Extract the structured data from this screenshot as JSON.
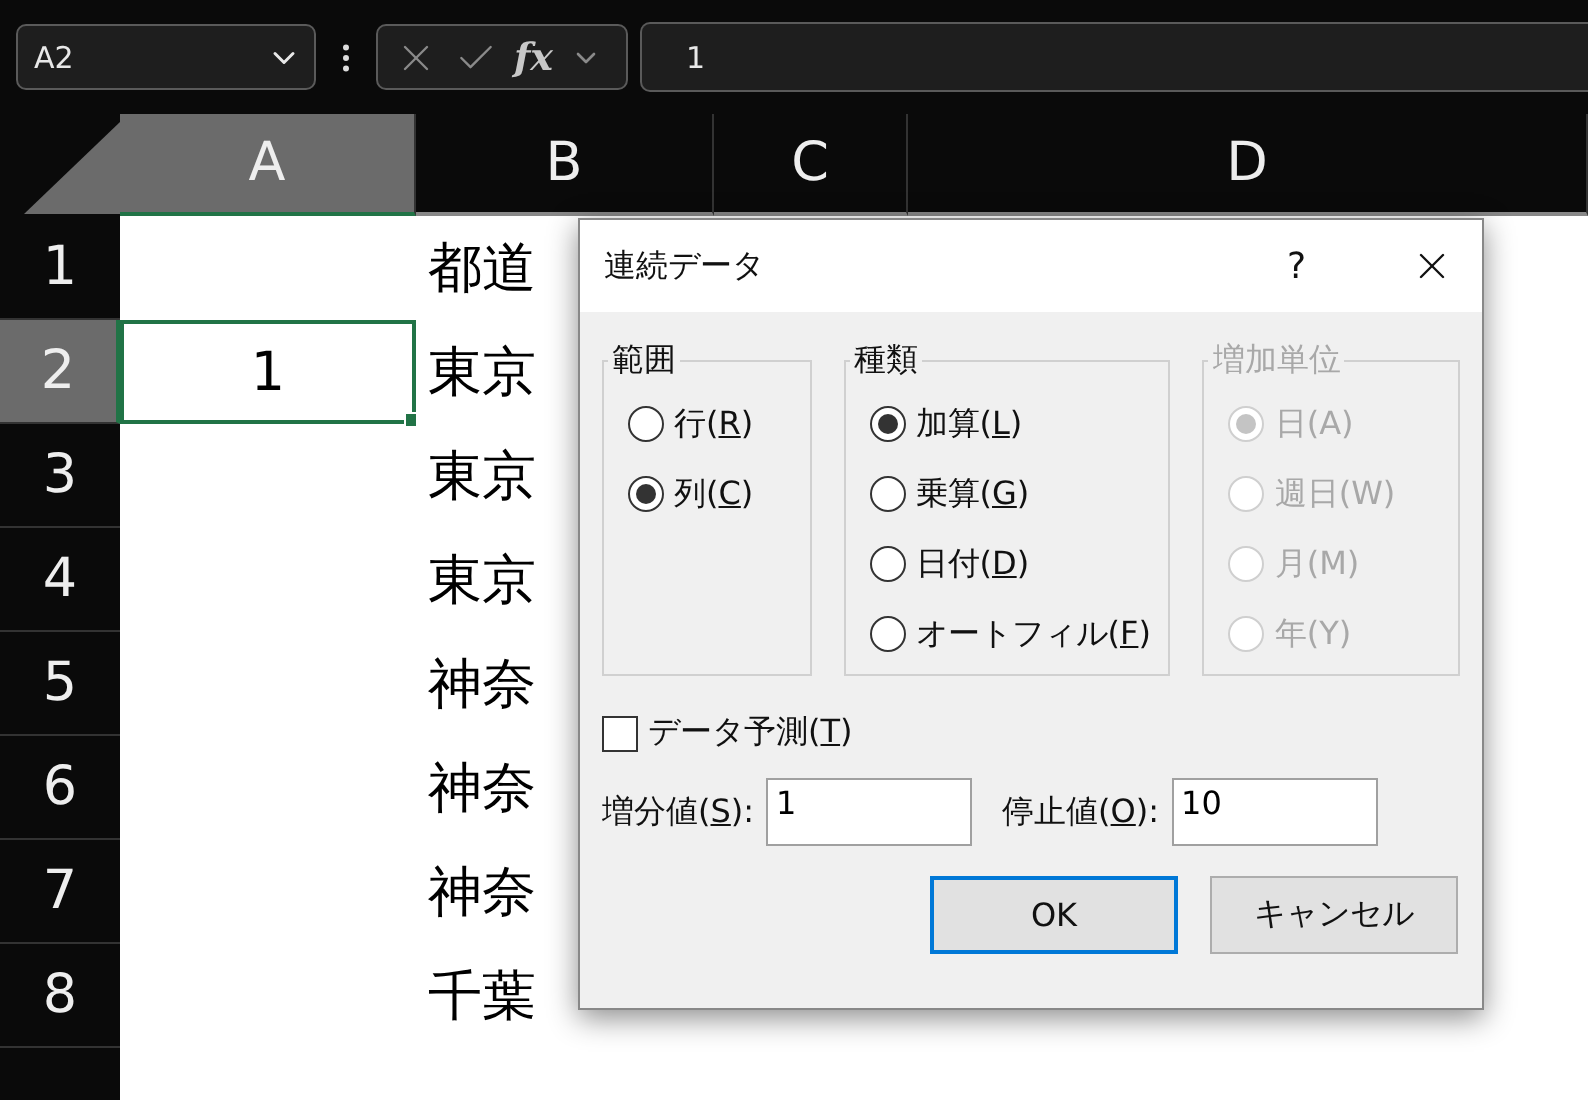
{
  "formula_bar": {
    "name_box": "A2",
    "fx": "fx",
    "value": "1"
  },
  "columns": [
    {
      "label": "A",
      "selected": true
    },
    {
      "label": "B",
      "selected": false
    },
    {
      "label": "C",
      "selected": false
    },
    {
      "label": "D",
      "selected": false
    }
  ],
  "rows": [
    {
      "label": "1",
      "selected": false,
      "cell_b": "都道"
    },
    {
      "label": "2",
      "selected": true,
      "cell_a": {
        "text": "1",
        "active": true
      },
      "cell_b": "東京"
    },
    {
      "label": "3",
      "selected": false,
      "cell_b": "東京"
    },
    {
      "label": "4",
      "selected": false,
      "cell_b": "東京"
    },
    {
      "label": "5",
      "selected": false,
      "cell_b": "神奈"
    },
    {
      "label": "6",
      "selected": false,
      "cell_b": "神奈"
    },
    {
      "label": "7",
      "selected": false,
      "cell_b": "神奈"
    },
    {
      "label": "8",
      "selected": false,
      "cell_b": "千葉"
    }
  ],
  "dialog": {
    "title": "連続データ",
    "help": "?",
    "groups": [
      {
        "title": "範囲",
        "disabled": false,
        "options": [
          {
            "label": "行(",
            "key": "R",
            "after": ")",
            "selected": false
          },
          {
            "label": "列(",
            "key": "C",
            "after": ")",
            "selected": true
          }
        ]
      },
      {
        "title": "種類",
        "disabled": false,
        "options": [
          {
            "label": "加算(",
            "key": "L",
            "after": ")",
            "selected": true
          },
          {
            "label": "乗算(",
            "key": "G",
            "after": ")",
            "selected": false
          },
          {
            "label": "日付(",
            "key": "D",
            "after": ")",
            "selected": false
          },
          {
            "label": "オートフィル(",
            "key": "F",
            "after": ")",
            "selected": false
          }
        ]
      },
      {
        "title": "増加単位",
        "disabled": true,
        "options": [
          {
            "label": "日(A)",
            "selected": true
          },
          {
            "label": "週日(W)",
            "selected": false
          },
          {
            "label": "月(M)",
            "selected": false
          },
          {
            "label": "年(Y)",
            "selected": false
          }
        ]
      }
    ],
    "checkbox": {
      "label": "データ予測(",
      "key": "T",
      "after": ")",
      "checked": false
    },
    "fields": [
      {
        "label": "増分値(",
        "key": "S",
        "after": "):",
        "value": "1"
      },
      {
        "label": "停止値(",
        "key": "O",
        "after": "):",
        "value": "10"
      }
    ],
    "buttons": [
      {
        "label": "OK",
        "default": true
      },
      {
        "label": "キャンセル",
        "default": false
      }
    ]
  }
}
